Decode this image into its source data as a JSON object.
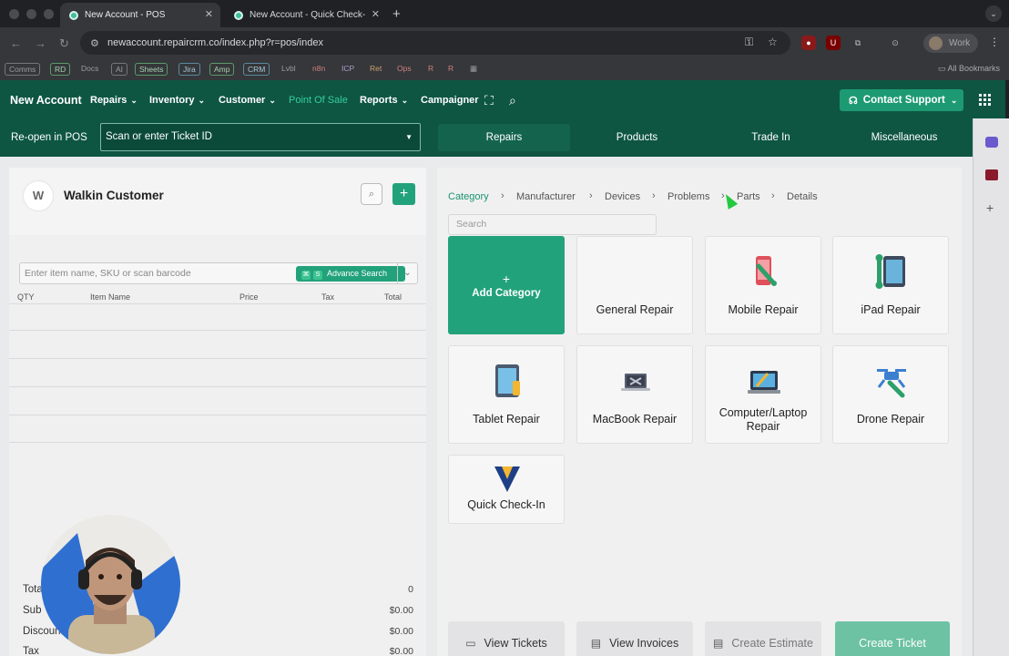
{
  "browser": {
    "tabs": [
      {
        "title": "New Account - POS",
        "active": true
      },
      {
        "title": "New Account - Quick Check-",
        "active": false
      }
    ],
    "url": "newaccount.repaircrm.co/index.php?r=pos/index",
    "profile_label": "Work",
    "bookmarks": [
      "Comms",
      "RD",
      "Docs",
      "AI",
      "Sheets",
      "Jira",
      "Amp",
      "CRM",
      "Lvbl",
      "n8n",
      "ICP",
      "Ret",
      "Ops",
      "R",
      "R"
    ],
    "all_bookmarks": "All Bookmarks"
  },
  "nav": {
    "brand": "New Account",
    "items": [
      {
        "label": "Repairs",
        "caret": true
      },
      {
        "label": "Inventory",
        "caret": true
      },
      {
        "label": "Customer",
        "caret": true
      },
      {
        "label": "Point Of Sale",
        "caret": false
      },
      {
        "label": "Reports",
        "caret": true
      },
      {
        "label": "Campaigner",
        "caret": false
      }
    ],
    "support_label": "Contact Support"
  },
  "subbar": {
    "reopen_label": "Re-open in POS",
    "ticket_placeholder": "Scan or enter Ticket ID",
    "tabs": [
      "Repairs",
      "Products",
      "Trade In",
      "Miscellaneous"
    ],
    "active_tab": "Repairs"
  },
  "customer": {
    "initial": "W",
    "name": "Walkin Customer"
  },
  "cart": {
    "search_placeholder": "Enter item name, SKU or scan barcode",
    "advance_search": "Advance Search",
    "shortcut_keys": [
      "⌘",
      "S"
    ],
    "columns": [
      "QTY",
      "Item Name",
      "Price",
      "Tax",
      "Total"
    ],
    "summary": [
      {
        "label": "Total",
        "value": "0"
      },
      {
        "label": "Sub",
        "value": "$0.00"
      },
      {
        "label": "Discoun",
        "value": "$0.00"
      },
      {
        "label": "Tax",
        "value": "$0.00"
      }
    ]
  },
  "catalog": {
    "breadcrumb": [
      "Category",
      "Manufacturer",
      "Devices",
      "Problems",
      "Parts",
      "Details"
    ],
    "search_placeholder": "Search",
    "add_label": "Add Category",
    "categories": [
      {
        "label": "General Repair",
        "icon": "none"
      },
      {
        "label": "Mobile Repair",
        "icon": "phone-wrench-icon"
      },
      {
        "label": "iPad Repair",
        "icon": "ipad-wrench-icon"
      },
      {
        "label": "Tablet Repair",
        "icon": "tablet-icon"
      },
      {
        "label": "MacBook Repair",
        "icon": "macbook-icon"
      },
      {
        "label": "Computer/Laptop Repair",
        "icon": "laptop-icon"
      },
      {
        "label": "Drone Repair",
        "icon": "drone-icon"
      },
      {
        "label": "Quick Check-In",
        "icon": "check-in-logo-icon"
      }
    ]
  },
  "actions": {
    "view_tickets": "View Tickets",
    "view_invoices": "View Invoices",
    "create_estimate": "Create Estimate",
    "create_ticket": "Create Ticket"
  },
  "colors": {
    "brand_green": "#0e5642",
    "accent_green": "#22a27a",
    "active_nav": "#33d19a"
  }
}
